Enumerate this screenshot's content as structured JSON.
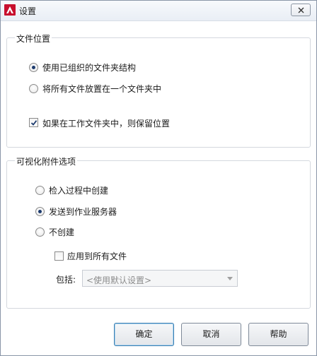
{
  "window": {
    "title": "设置",
    "accent_color": "#c8102e"
  },
  "file_location": {
    "group_title": "文件位置",
    "options": [
      {
        "label": "使用已组织的文件夹结构",
        "checked": true
      },
      {
        "label": "将所有文件放置在一个文件夹中",
        "checked": false
      }
    ],
    "keep_location_label": "如果在工作文件夹中，则保留位置",
    "keep_location_checked": true
  },
  "xref_options": {
    "group_title": "可视化附件选项",
    "options": [
      {
        "label": "检入过程中创建",
        "checked": false
      },
      {
        "label": "发送到作业服务器",
        "checked": true
      },
      {
        "label": "不创建",
        "checked": false
      }
    ],
    "apply_all_label": "应用到所有文件",
    "apply_all_checked": false,
    "include_label": "包括:",
    "include_value": "<使用默认设置>"
  },
  "buttons": {
    "ok": "确定",
    "cancel": "取消",
    "help": "帮助"
  }
}
